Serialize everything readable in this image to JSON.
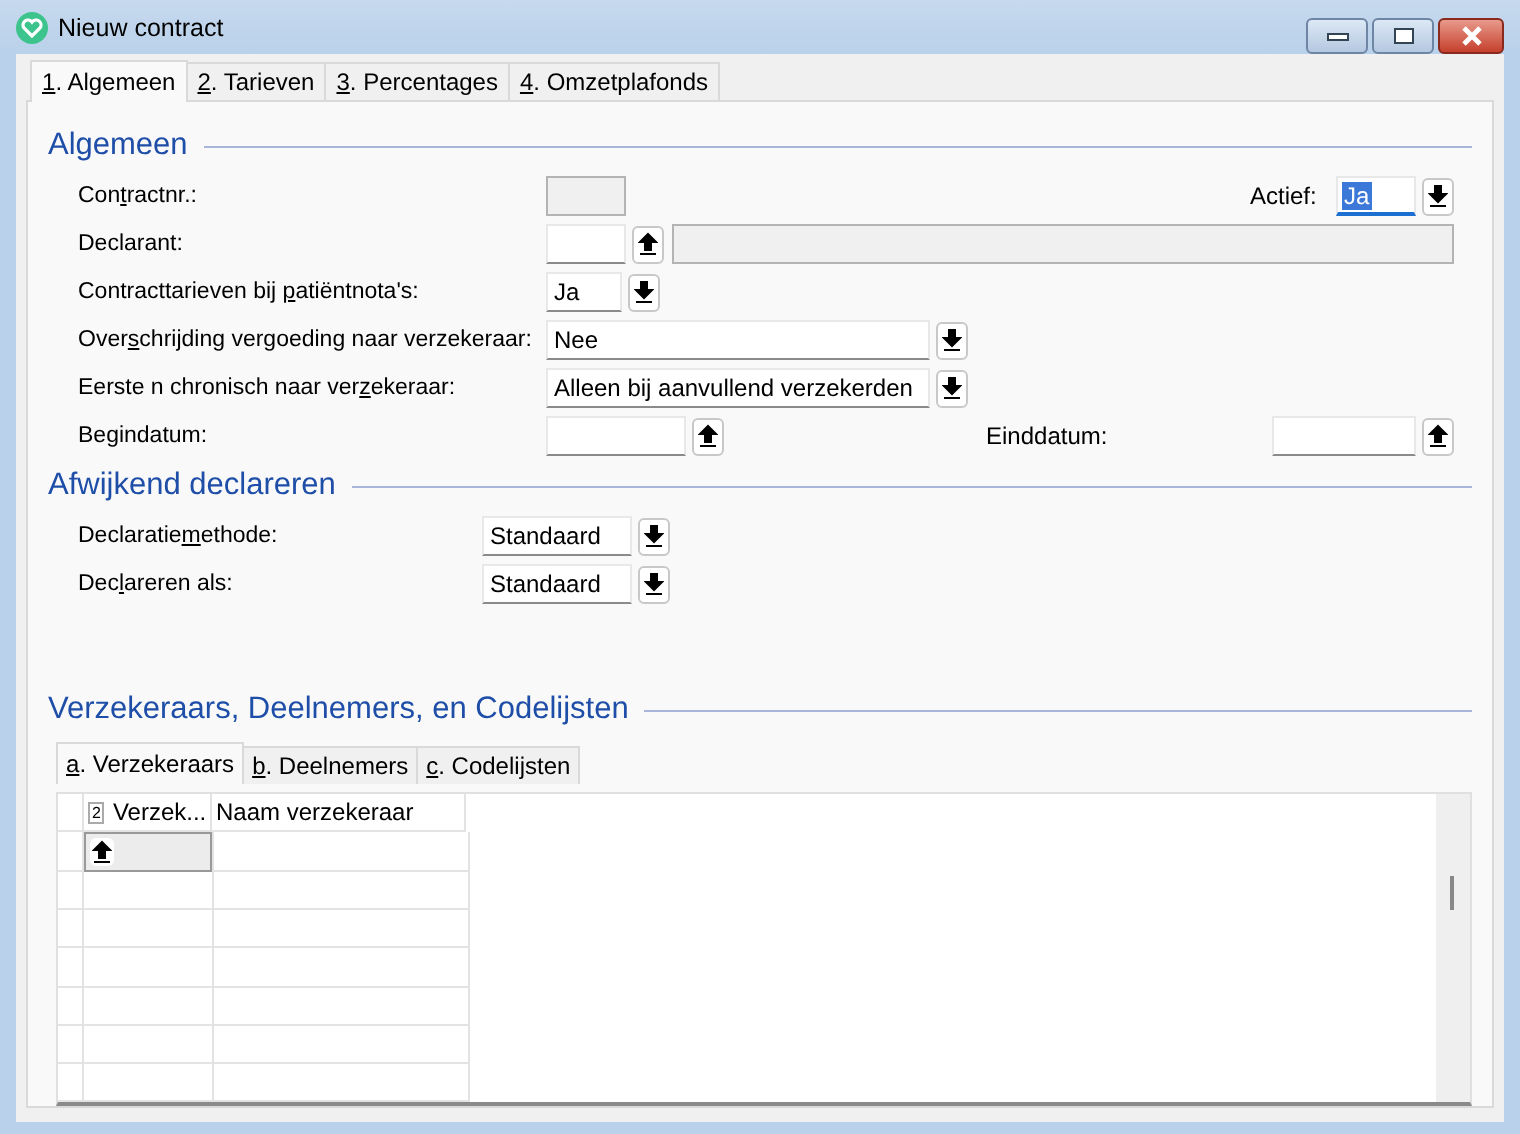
{
  "window": {
    "title": "Nieuw contract"
  },
  "tabs": [
    {
      "key": "1",
      "post": ". Algemeen",
      "selected": true
    },
    {
      "key": "2",
      "post": ". Tarieven",
      "selected": false
    },
    {
      "key": "3",
      "post": ". Percentages",
      "selected": false
    },
    {
      "key": "4",
      "post": ". Omzetplafonds",
      "selected": false
    }
  ],
  "algemeen": {
    "title": "Algemeen",
    "rows": [
      {
        "label": {
          "pre": "Con",
          "key": "t",
          "post": "ractnr.:"
        },
        "control": {
          "kind": "readonly"
        },
        "right": {
          "label": {
            "post": "Actief:"
          },
          "control": {
            "kind": "combo",
            "value": "Ja",
            "focused": true
          }
        }
      },
      {
        "label": {
          "post": "Declarant:"
        },
        "control": {
          "kind": "described-lookup"
        }
      },
      {
        "label": {
          "pre": "Contracttarieven bij ",
          "key": "p",
          "post": "atiëntnota's:"
        },
        "control": {
          "kind": "combo",
          "value": "Ja",
          "focused": false
        }
      },
      {
        "label": {
          "pre": "Over",
          "key": "s",
          "post": "chrijding vergoeding naar verzekeraar:"
        },
        "control": {
          "kind": "combo",
          "value": "Nee",
          "focused": false
        }
      },
      {
        "label": {
          "pre": "Eerste n chronisch naar ver",
          "key": "z",
          "post": "ekeraar:"
        },
        "control": {
          "kind": "combo",
          "value": "Alleen bij aanvullend verzekerden",
          "focused": false
        }
      },
      {
        "label": {
          "post": "Begindatum:"
        },
        "control": {
          "kind": "lookup"
        },
        "right": {
          "label": {
            "post": "Einddatum:"
          },
          "control": {
            "kind": "lookup"
          }
        }
      }
    ]
  },
  "afwijkend": {
    "title": "Afwijkend declareren",
    "rows": [
      {
        "label": {
          "pre": "Declaratie",
          "key": "m",
          "post": "ethode:"
        },
        "control": {
          "kind": "combo",
          "value": "Standaard",
          "focused": false
        }
      },
      {
        "label": {
          "pre": "Dec",
          "key": "l",
          "post": "areren als:"
        },
        "control": {
          "kind": "combo",
          "value": "Standaard",
          "focused": false
        }
      }
    ]
  },
  "verzekeraars": {
    "title": "Verzekeraars, Deelnemers, en Codelijsten",
    "tabs": [
      {
        "key": "a",
        "post": ". Verzekeraars",
        "selected": true
      },
      {
        "key": "b",
        "post": ". Deelnemers",
        "selected": false
      },
      {
        "key": "c",
        "post": ". Codelijsten",
        "selected": false
      }
    ],
    "grid": {
      "columns": [
        {
          "sort_badge": "2",
          "label": "Verzek..."
        },
        {
          "label": "Naam verzekeraar"
        }
      ],
      "rows": [
        {
          "editing": true
        },
        {
          "editing": false
        },
        {
          "editing": false
        },
        {
          "editing": false
        },
        {
          "editing": false
        },
        {
          "editing": false
        },
        {
          "editing": false
        }
      ]
    }
  }
}
